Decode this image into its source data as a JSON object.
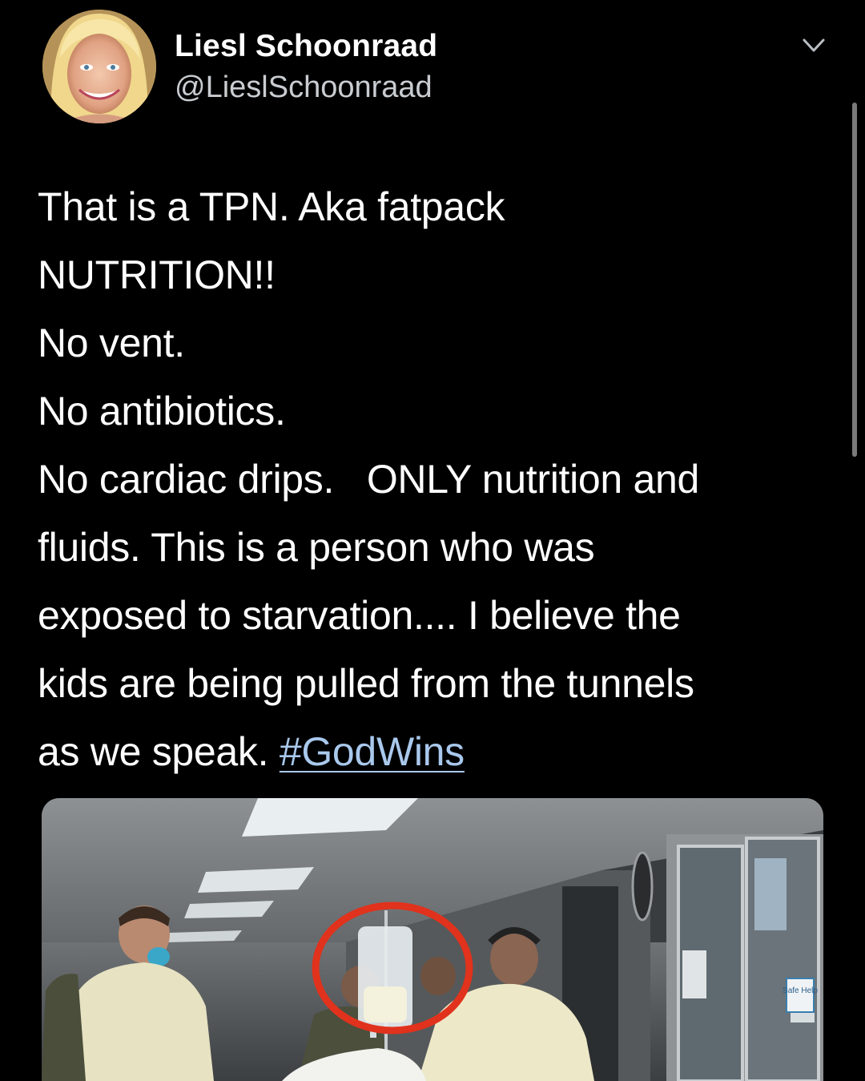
{
  "tweet": {
    "author": {
      "name": "Liesl Schoonraad",
      "handle": "@LieslSchoonraad"
    },
    "text_lines": [
      "That is a TPN. Aka fatpack",
      "NUTRITION!!",
      "No vent.",
      "No antibiotics.",
      "No cardiac drips.   ONLY nutrition and",
      "fluids. This is a person who was",
      "exposed to starvation.... I believe the",
      "kids are being pulled from the tunnels",
      "as we speak. "
    ],
    "hashtag": "#GodWins",
    "media": {
      "sign_text": "Safe Help"
    }
  },
  "icons": {
    "menu": "chevron-down-icon"
  },
  "colors": {
    "background": "#000000",
    "text": "#ffffff",
    "handle": "#c9cdd1",
    "link": "#a9c8ec",
    "circle_annotation": "#e0321c"
  }
}
